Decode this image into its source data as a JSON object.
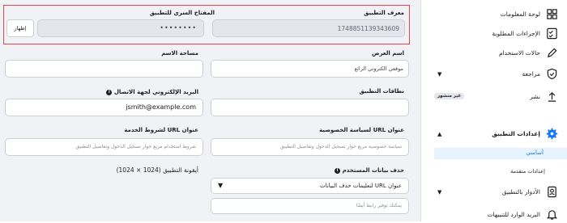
{
  "app_id": {
    "label": "معرف التطبيق",
    "value": "1748851139343609"
  },
  "app_secret": {
    "label": "المفتاح السري للتطبيق",
    "value": "••••••••",
    "show_label": "إظهار"
  },
  "display_name": {
    "label": "اسم العرض",
    "value": "موقعي الكتروني الرائع"
  },
  "namespace": {
    "label": "مساحة الاسم",
    "value": ""
  },
  "app_domains": {
    "label": "نطاقات التطبيق",
    "value": ""
  },
  "contact_email": {
    "label": "البريد الإلكتروني لجهة الاتصال",
    "value": "jsmith@example.com",
    "info": "i"
  },
  "privacy_url": {
    "label": "عنوان URL لسياسة الخصوصية",
    "placeholder": "سياسة خصوصية مربع حوار تسجيل الدخول وتفاصيل التطبيق"
  },
  "terms_url": {
    "label": "عنوان URL لشروط الخدمة",
    "placeholder": "شروط استخدام مربع حوار تسجيل الدخول وتفاصيل التطبيق"
  },
  "data_deletion": {
    "label": "حذف بيانات المستخدم",
    "info": "i",
    "select_value": "عنوان URL لتعليمات حذف البيانات",
    "url_placeholder": "يمكنك توفير رابط أيضًا"
  },
  "app_icon": {
    "label": "أيقونة التطبيق (1024 × 1024)"
  },
  "sidebar": {
    "items": [
      {
        "label": "لوحة المعلومات",
        "icon": "dashboard-icon"
      },
      {
        "label": "الإجراءات المطلوبة",
        "icon": "checklist-icon"
      },
      {
        "label": "حالات الاستخدام",
        "icon": "pencil-icon"
      },
      {
        "label": "مراجعة",
        "icon": "shield-check-icon"
      },
      {
        "label": "نشر",
        "icon": "upload-icon",
        "badge": "غير منشور"
      },
      {
        "label": "إعدادات التطبيق",
        "icon": "gear-icon"
      },
      {
        "label": "الأدوار بالتطبيق",
        "icon": "person-icon"
      },
      {
        "label": "البريد الوارد للتنبيهات",
        "icon": "bell-icon"
      }
    ],
    "settings_sub": {
      "basic": "أساسي",
      "advanced": "إعدادات متقدمة"
    }
  },
  "colors": {
    "accent": "#1877f2",
    "frame": "#e6474e",
    "selected_bg": "#e7f3ff"
  }
}
